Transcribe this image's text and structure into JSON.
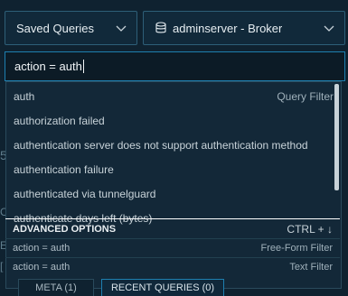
{
  "header": {
    "saved_queries_label": "Saved Queries",
    "server_label": "adminserver - Broker"
  },
  "query": {
    "value": "action = auth"
  },
  "background": {
    "frag1": "5",
    "frag2": "C",
    "frag3": "E",
    "frag4": "["
  },
  "suggestions": [
    {
      "text": "auth",
      "type": "Query Filter"
    },
    {
      "text": "authorization failed",
      "type": ""
    },
    {
      "text": "authentication server does not support authentication method",
      "type": ""
    },
    {
      "text": "authentication failure",
      "type": ""
    },
    {
      "text": "authenticated via tunnelguard",
      "type": ""
    },
    {
      "text": "authenticate days left (bytes)",
      "type": ""
    }
  ],
  "advanced": {
    "title": "ADVANCED OPTIONS",
    "shortcut": "CTRL + ↓",
    "options": [
      {
        "text": "action = auth",
        "type": "Free-Form Filter"
      },
      {
        "text": "action = auth",
        "type": "Text Filter"
      }
    ]
  },
  "tabs": {
    "meta": "META (1)",
    "recent": "RECENT QUERIES (0)"
  },
  "colors": {
    "background": "#0f2230",
    "accent": "#1e7fb0",
    "border": "#2e5f78"
  }
}
